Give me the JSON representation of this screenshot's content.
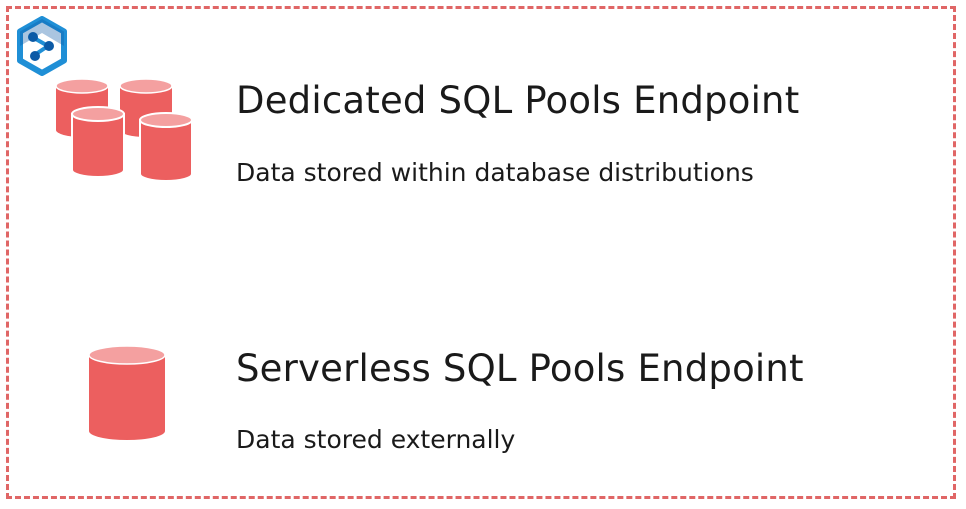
{
  "colors": {
    "border": "#e06666",
    "cylinder_body": "#ec5f5f",
    "cylinder_top": "#f4a0a0",
    "logo_blue": "#1f8fd6",
    "logo_dark": "#0b5aa6"
  },
  "icons": {
    "logo": "azure-synapse-icon",
    "dedicated": "database-cluster-icon",
    "serverless": "database-icon"
  },
  "dedicated": {
    "title": "Dedicated SQL Pools Endpoint",
    "description": "Data stored within database distributions"
  },
  "serverless": {
    "title": "Serverless SQL Pools Endpoint",
    "description": "Data stored externally"
  }
}
